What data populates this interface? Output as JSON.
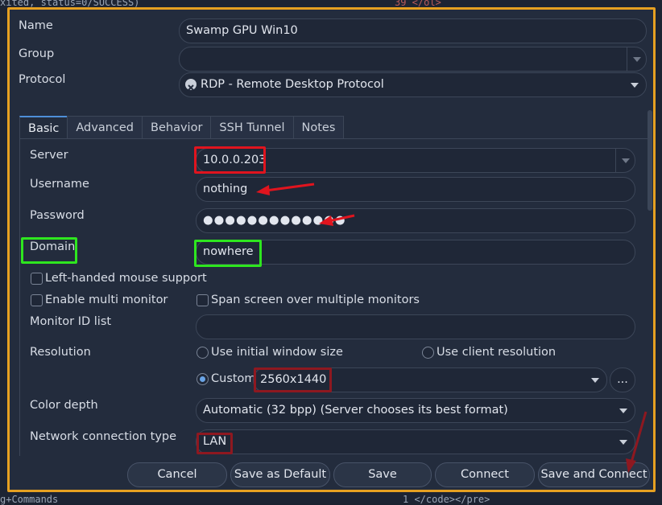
{
  "background": {
    "top_left": "xited, status=0/SUCCESS)",
    "top_right": "39 </ol>",
    "bottom_left": "g+Commands",
    "bottom_right": "1  </code></pre>"
  },
  "form": {
    "name_label": "Name",
    "name_value": "Swamp GPU Win10",
    "group_label": "Group",
    "group_value": "",
    "protocol_label": "Protocol",
    "protocol_value": "RDP - Remote Desktop Protocol"
  },
  "tabs": [
    "Basic",
    "Advanced",
    "Behavior",
    "SSH Tunnel",
    "Notes"
  ],
  "basic": {
    "server_label": "Server",
    "server_value": "10.0.0.203",
    "username_label": "Username",
    "username_value": "nothing",
    "password_label": "Password",
    "password_value": "●●●●●●●●●●●●●",
    "domain_label": "Domain",
    "domain_value": "nowhere",
    "left_handed_label": "Left-handed mouse support",
    "multi_monitor_label": "Enable multi monitor",
    "span_screen_label": "Span screen over multiple monitors",
    "monitor_id_label": "Monitor ID list",
    "monitor_id_value": "",
    "resolution_label": "Resolution",
    "use_initial_label": "Use initial window size",
    "use_client_label": "Use client resolution",
    "custom_label": "Custom",
    "custom_value": "2560x1440",
    "ellipsis_label": "...",
    "color_depth_label": "Color depth",
    "color_depth_value": "Automatic (32 bpp) (Server chooses its best format)",
    "network_label": "Network connection type",
    "network_value": "LAN"
  },
  "buttons": {
    "cancel": "Cancel",
    "save_default": "Save as Default",
    "save": "Save",
    "connect": "Connect",
    "save_connect": "Save and Connect"
  },
  "colors": {
    "dialog_border": "#e6a021",
    "annotation_red": "#e0141e",
    "annotation_green": "#2ee61f",
    "annotation_darkred": "#8e1820"
  }
}
